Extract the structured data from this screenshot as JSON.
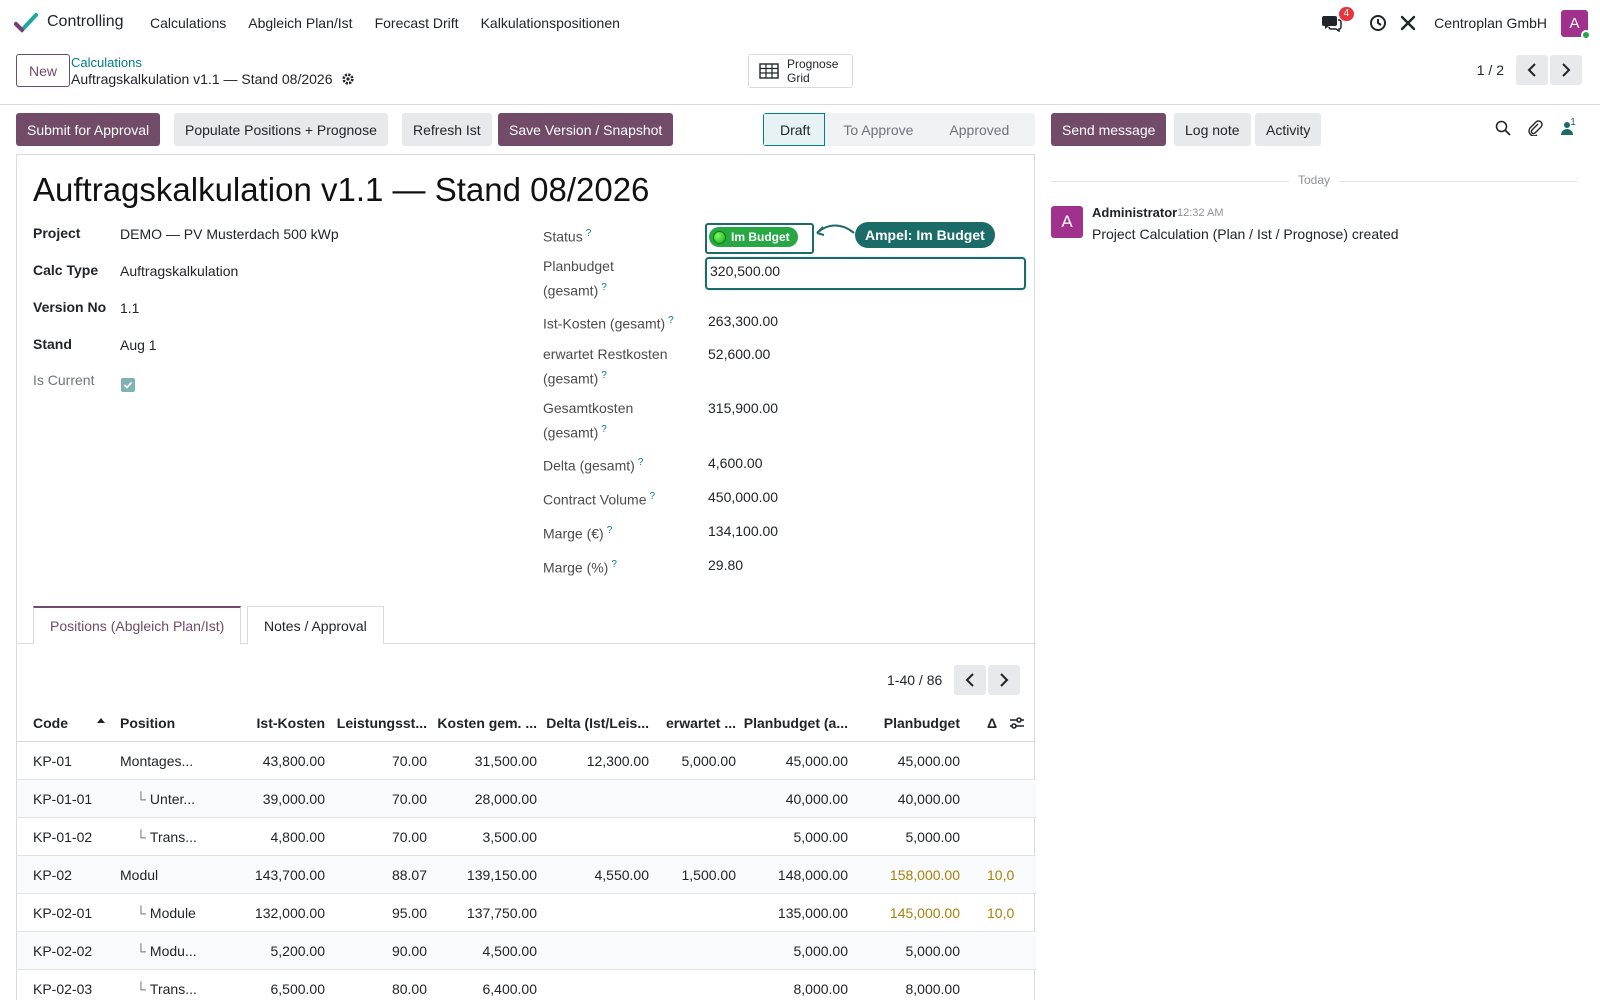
{
  "navbar": {
    "app_name": "Controlling",
    "menu": [
      "Calculations",
      "Abgleich Plan/Ist",
      "Forecast Drift",
      "Kalkulationspositionen"
    ],
    "messages_count": "4",
    "company": "Centroplan GmbH",
    "avatar_letter": "A"
  },
  "control_panel": {
    "new_label": "New",
    "breadcrumb_parent": "Calculations",
    "breadcrumb_current": "Auftragskalkulation v1.1 — Stand 08/2026",
    "prognose_label_1": "Prognose",
    "prognose_label_2": "Grid",
    "pager": "1 / 2"
  },
  "actions": {
    "submit": "Submit for Approval",
    "populate": "Populate Positions + Prognose",
    "refresh": "Refresh Ist",
    "save_version": "Save Version / Snapshot"
  },
  "statusbar": {
    "stages": [
      "Draft",
      "To Approve",
      "Approved"
    ],
    "active": "Draft"
  },
  "form": {
    "title": "Auftragskalkulation v1.1 — Stand 08/2026",
    "left": {
      "project_label": "Project",
      "project_value": "DEMO — PV Musterdach 500 kWp",
      "calc_type_label": "Calc Type",
      "calc_type_value": "Auftragskalkulation",
      "version_label": "Version No",
      "version_value": "1.1",
      "stand_label": "Stand",
      "stand_value": "Aug 1",
      "is_current_label": "Is Current",
      "is_current": true
    },
    "right": {
      "status_label": "Status",
      "status_value": "Im Budget",
      "callout": "Ampel: Im Budget",
      "planbudget_label_1": "Planbudget",
      "planbudget_label_2": "(gesamt)",
      "planbudget_value": "320,500.00",
      "ist_label": "Ist-Kosten (gesamt)",
      "ist_value": "263,300.00",
      "rest_label_1": "erwartet Restkosten",
      "rest_label_2": "(gesamt)",
      "rest_value": "52,600.00",
      "gesamt_label_1": "Gesamtkosten",
      "gesamt_label_2": "(gesamt)",
      "gesamt_value": "315,900.00",
      "delta_label": "Delta (gesamt)",
      "delta_value": "4,600.00",
      "contract_label": "Contract Volume",
      "contract_value": "450,000.00",
      "marge_eur_label": "Marge (€)",
      "marge_eur_value": "134,100.00",
      "marge_pct_label": "Marge (%)",
      "marge_pct_value": "29.80"
    }
  },
  "tabs": [
    "Positions (Abgleich Plan/Ist)",
    "Notes / Approval"
  ],
  "list": {
    "pager": "1-40 / 86",
    "columns": [
      "Code",
      "Position",
      "Ist-Kosten",
      "Leistungsst...",
      "Kosten gem. ...",
      "Delta (Ist/Leis...",
      "erwartet ...",
      "Planbudget (a...",
      "Planbudget",
      "Δ"
    ],
    "rows": [
      {
        "code": "KP-01",
        "position": "Montages...",
        "sub": false,
        "ist": "43,800.00",
        "leist": "70.00",
        "kosten": "31,500.00",
        "delta": "12,300.00",
        "erwartet": "5,000.00",
        "plan_a": "45,000.00",
        "plan": "45,000.00",
        "d": "",
        "warn": false
      },
      {
        "code": "KP-01-01",
        "position": "Unter...",
        "sub": true,
        "ist": "39,000.00",
        "leist": "70.00",
        "kosten": "28,000.00",
        "delta": "",
        "erwartet": "",
        "plan_a": "40,000.00",
        "plan": "40,000.00",
        "d": "",
        "warn": false
      },
      {
        "code": "KP-01-02",
        "position": "Trans...",
        "sub": true,
        "ist": "4,800.00",
        "leist": "70.00",
        "kosten": "3,500.00",
        "delta": "",
        "erwartet": "",
        "plan_a": "5,000.00",
        "plan": "5,000.00",
        "d": "",
        "warn": false
      },
      {
        "code": "KP-02",
        "position": "Modul",
        "sub": false,
        "ist": "143,700.00",
        "leist": "88.07",
        "kosten": "139,150.00",
        "delta": "4,550.00",
        "erwartet": "1,500.00",
        "plan_a": "148,000.00",
        "plan": "158,000.00",
        "d": "10,0",
        "warn": true
      },
      {
        "code": "KP-02-01",
        "position": "Module",
        "sub": true,
        "ist": "132,000.00",
        "leist": "95.00",
        "kosten": "137,750.00",
        "delta": "",
        "erwartet": "",
        "plan_a": "135,000.00",
        "plan": "145,000.00",
        "d": "10,0",
        "warn": true
      },
      {
        "code": "KP-02-02",
        "position": "Modu...",
        "sub": true,
        "ist": "5,200.00",
        "leist": "90.00",
        "kosten": "4,500.00",
        "delta": "",
        "erwartet": "",
        "plan_a": "5,000.00",
        "plan": "5,000.00",
        "d": "",
        "warn": false
      },
      {
        "code": "KP-02-03",
        "position": "Trans...",
        "sub": true,
        "ist": "6,500.00",
        "leist": "80.00",
        "kosten": "6,400.00",
        "delta": "",
        "erwartet": "",
        "plan_a": "8,000.00",
        "plan": "8,000.00",
        "d": "",
        "warn": false
      }
    ]
  },
  "chatter": {
    "send_message": "Send message",
    "log_note": "Log note",
    "activity": "Activity",
    "followers_count": "1",
    "date_separator": "Today",
    "message": {
      "avatar_letter": "A",
      "author": "Administrator",
      "time": "12:32 AM",
      "body": "Project Calculation (Plan / Ist / Prognose) created"
    }
  },
  "colors": {
    "primary": "#714b67",
    "accent_teal": "#017e84",
    "status_green": "#28a745",
    "callout": "#1b6b68",
    "warning_text": "#a9810a"
  }
}
